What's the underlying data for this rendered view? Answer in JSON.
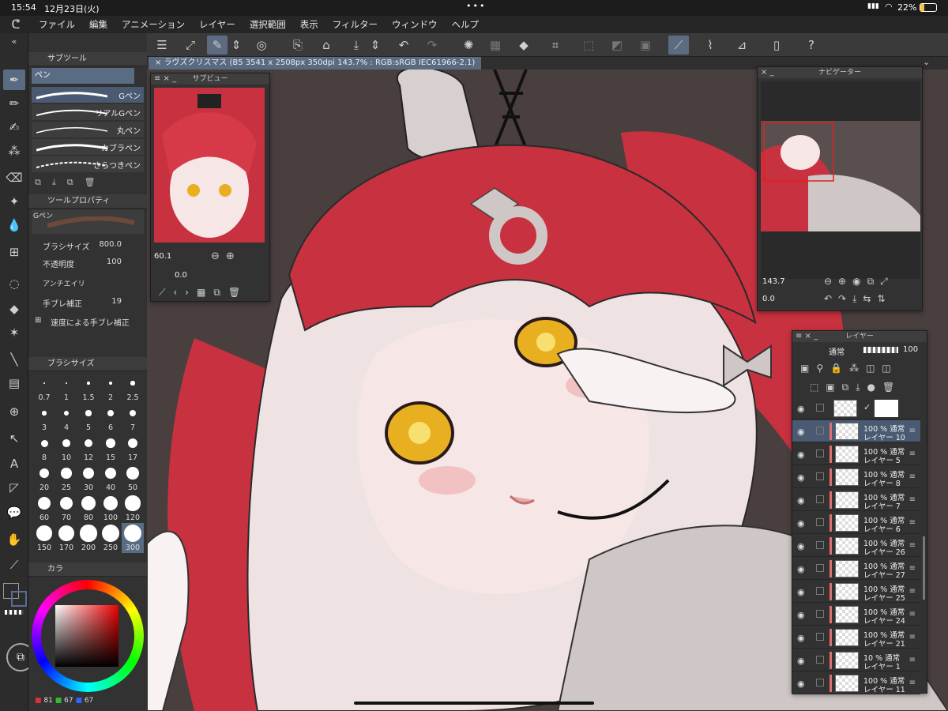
{
  "status": {
    "time": "15:54",
    "date": "12月23日(火)",
    "battery": "22%"
  },
  "menu": [
    "ファイル",
    "編集",
    "アニメーション",
    "レイヤー",
    "選択範囲",
    "表示",
    "フィルター",
    "ウィンドウ",
    "ヘルプ"
  ],
  "document": {
    "tab": "ラヴズクリスマス (B5 3541 x 2508px 350dpi 143.7% : RGB:sRGB IEC61966-2.1)"
  },
  "subtool": {
    "title": "サブツール",
    "group": "ペン",
    "brushes": [
      "Gペン",
      "リアルGペン",
      "丸ペン",
      "カブラペン",
      "さらつきペン"
    ]
  },
  "toolprop": {
    "title": "ツールプロパティ",
    "current": "Gペン",
    "brush_size_label": "ブラシサイズ",
    "brush_size": "800.0",
    "opacity_label": "不透明度",
    "opacity": "100",
    "aa_label": "アンチエイリ",
    "stab_label": "手ブレ補正",
    "stab": "19",
    "speed_label": "速度による手ブレ補正"
  },
  "brushsize": {
    "title": "ブラシサイズ",
    "sizes": [
      "0.7",
      "1",
      "1.5",
      "2",
      "2.5",
      "3",
      "4",
      "5",
      "6",
      "7",
      "8",
      "10",
      "12",
      "15",
      "17",
      "20",
      "25",
      "30",
      "40",
      "50",
      "60",
      "70",
      "80",
      "100",
      "120",
      "150",
      "170",
      "200",
      "250",
      "300"
    ]
  },
  "color": {
    "title": "カラ",
    "r": "81",
    "g": "67",
    "b": "67",
    "main": "#e8c8c8",
    "sub": "#5a6b9a"
  },
  "subview": {
    "title": "サブビュー",
    "zoom": "60.1",
    "angle": "0.0"
  },
  "navigator": {
    "title": "ナビゲーター",
    "zoom": "143.7",
    "angle": "0.0"
  },
  "layers": {
    "title": "レイヤー",
    "blend": "通常",
    "opacity": "100",
    "rows": [
      {
        "p": "",
        "name": "",
        "paper": true
      },
      {
        "p": "100 % 通常",
        "name": "レイヤー 10",
        "sel": true
      },
      {
        "p": "100 % 通常",
        "name": "レイヤー 5"
      },
      {
        "p": "100 % 通常",
        "name": "レイヤー 8"
      },
      {
        "p": "100 % 通常",
        "name": "レイヤー 7"
      },
      {
        "p": "100 % 通常",
        "name": "レイヤー 6"
      },
      {
        "p": "100 % 通常",
        "name": "レイヤー 26"
      },
      {
        "p": "100 % 通常",
        "name": "レイヤー 27"
      },
      {
        "p": "100 % 通常",
        "name": "レイヤー 25"
      },
      {
        "p": "100 % 通常",
        "name": "レイヤー 24"
      },
      {
        "p": "100 % 通常",
        "name": "レイヤー 21"
      },
      {
        "p": "10 % 通常",
        "name": "レイヤー 1"
      },
      {
        "p": "100 % 通常",
        "name": "レイヤー 11"
      }
    ]
  },
  "colors": {
    "accent": "#5a6b84",
    "hair": "#c8313f",
    "skin": "#f2dede",
    "bg": "#4a3f3f"
  }
}
